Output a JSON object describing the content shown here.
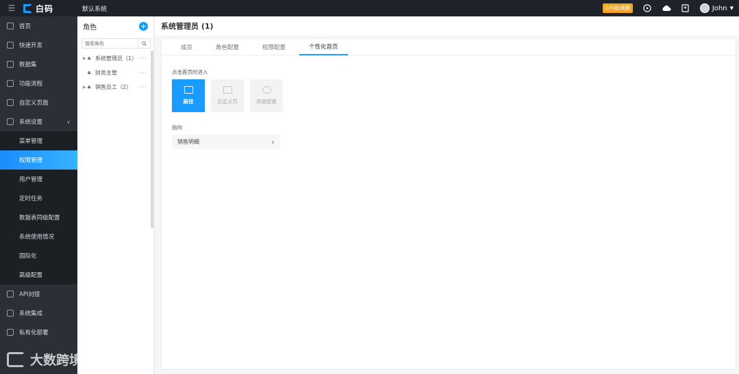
{
  "topbar": {
    "logo_text": "白码",
    "system_name": "默认系统",
    "upgrade_label": "⊙升级/续费",
    "user_name": "John"
  },
  "sidebar": {
    "items": [
      {
        "label": "首页",
        "icon": "home-icon"
      },
      {
        "label": "快速开发",
        "icon": "cube-icon"
      },
      {
        "label": "数据集",
        "icon": "database-icon"
      },
      {
        "label": "功能流程",
        "icon": "flow-icon"
      },
      {
        "label": "自定义页面",
        "icon": "page-icon"
      },
      {
        "label": "系统设置",
        "icon": "monitor-icon"
      }
    ],
    "sub_items": [
      {
        "label": "菜单管理"
      },
      {
        "label": "权限管理"
      },
      {
        "label": "用户管理"
      },
      {
        "label": "定时任务"
      },
      {
        "label": "数据表同级配置"
      },
      {
        "label": "系统使用情况"
      },
      {
        "label": "国际化"
      },
      {
        "label": "高级配置"
      }
    ],
    "bottom_items": [
      {
        "label": "API对接",
        "icon": "api-icon"
      },
      {
        "label": "系统集成",
        "icon": "layers-icon"
      },
      {
        "label": "私有化部署",
        "icon": "server-icon"
      }
    ],
    "watermark": "大数跨境"
  },
  "role_panel": {
    "title": "角色",
    "search_placeholder": "搜索角色",
    "roles": [
      {
        "label": "系统管理员（1）",
        "expandable": true
      },
      {
        "label": "财务主管",
        "expandable": false
      },
      {
        "label": "销售员工（2）",
        "expandable": true
      }
    ]
  },
  "main": {
    "title": "系统管理员 (1)",
    "tabs": [
      {
        "label": "成员"
      },
      {
        "label": "角色配置"
      },
      {
        "label": "权限配置"
      },
      {
        "label": "个性化首页"
      }
    ],
    "section_label": "点击首页时进入",
    "tiles": [
      {
        "label": "路径",
        "icon": "grid-doc-icon"
      },
      {
        "label": "自定义页",
        "icon": "image-icon"
      },
      {
        "label": "高级配置",
        "icon": "gear-icon"
      }
    ],
    "point_label": "指向",
    "select_value": "销售明细"
  },
  "colors": {
    "accent": "#1a9bff",
    "sidebar_bg": "#2b2f36",
    "topbar_bg": "#1f2329",
    "upgrade": "#f5a623"
  }
}
